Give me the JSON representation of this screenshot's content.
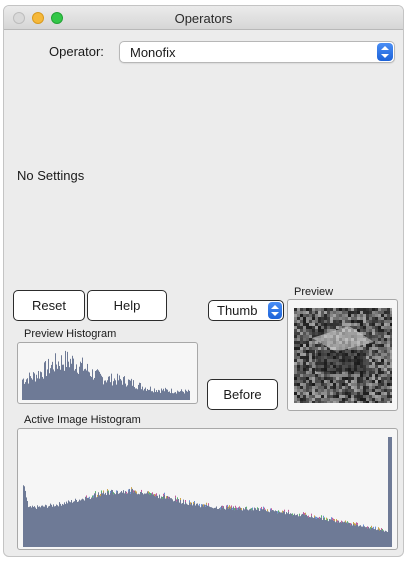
{
  "window": {
    "title": "Operators"
  },
  "operator": {
    "label": "Operator:",
    "value": "Monofix"
  },
  "settings": {
    "empty_text": "No Settings"
  },
  "buttons": {
    "reset": "Reset",
    "help": "Help",
    "before": "Before"
  },
  "view_mode": {
    "value": "Thumb"
  },
  "labels": {
    "preview_histogram": "Preview Histogram",
    "preview": "Preview",
    "active_image_histogram": "Active Image Histogram"
  },
  "colors": {
    "histogram_fill": "#6e7a96",
    "accent_blue": "#1c62d8"
  },
  "icons": {
    "close": "close-dot-icon",
    "minimize": "minimize-dot-icon",
    "zoom": "zoom-dot-icon",
    "select_arrows": "updown-chevron-icon"
  }
}
